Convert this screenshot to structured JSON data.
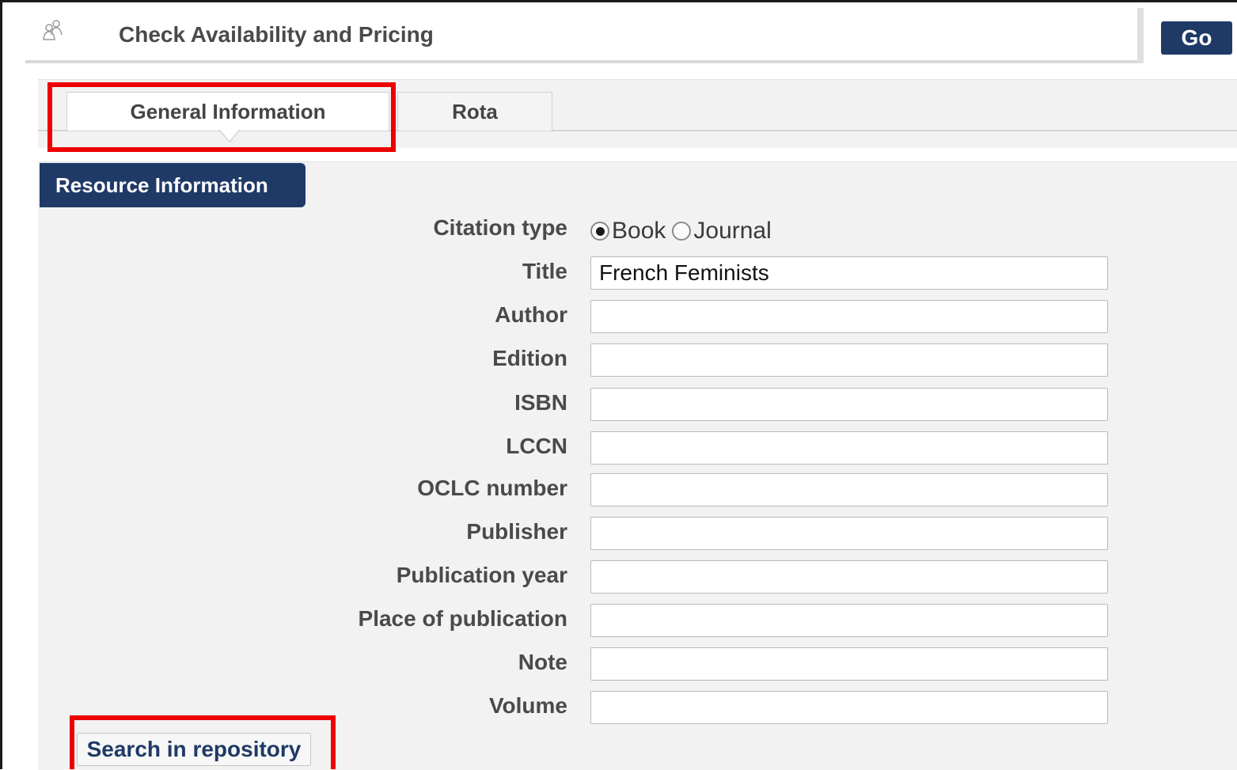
{
  "header": {
    "title": "Check Availability and Pricing",
    "icon": "users-icon",
    "go_label": "Go"
  },
  "tabs": [
    {
      "label": "General Information",
      "active": true
    },
    {
      "label": "Rota",
      "active": false
    }
  ],
  "section": {
    "title": "Resource Information"
  },
  "citation_type": {
    "label": "Citation type",
    "options": [
      {
        "label": "Book",
        "checked": true
      },
      {
        "label": "Journal",
        "checked": false
      }
    ]
  },
  "fields": {
    "title": {
      "label": "Title",
      "value": "French Feminists"
    },
    "author": {
      "label": "Author",
      "value": ""
    },
    "edition": {
      "label": "Edition",
      "value": ""
    },
    "isbn": {
      "label": "ISBN",
      "value": ""
    },
    "lccn": {
      "label": "LCCN",
      "value": ""
    },
    "oclc": {
      "label": "OCLC number",
      "value": ""
    },
    "publisher": {
      "label": "Publisher",
      "value": ""
    },
    "pub_year": {
      "label": "Publication year",
      "value": ""
    },
    "place": {
      "label": "Place of publication",
      "value": ""
    },
    "note": {
      "label": "Note",
      "value": ""
    },
    "volume": {
      "label": "Volume",
      "value": ""
    }
  },
  "actions": {
    "search_label": "Search in repository"
  },
  "colors": {
    "accent": "#1f3a66",
    "highlight": "#ee0000",
    "panel_bg": "#f2f2f2"
  }
}
